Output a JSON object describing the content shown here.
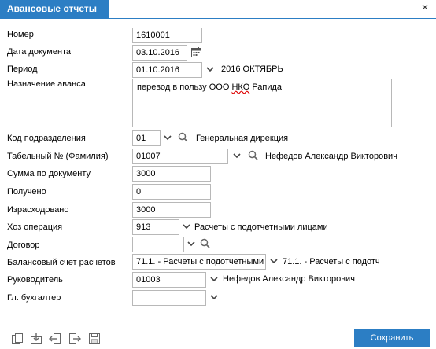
{
  "window": {
    "title": "Авансовые отчеты",
    "close_glyph": "×"
  },
  "fields": {
    "nomer": {
      "label": "Номер",
      "value": "1610001"
    },
    "data_doc": {
      "label": "Дата документа",
      "value": "03.10.2016"
    },
    "period": {
      "label": "Период",
      "value": "01.10.2016",
      "caption": "2016 ОКТЯБРЬ"
    },
    "naznachenie": {
      "label": "Назначение аванса",
      "value_prefix": "перевод в пользу ООО ",
      "value_marked": "НКО",
      "value_suffix": " Рапида"
    },
    "kod_podr": {
      "label": "Код подразделения",
      "value": "01",
      "caption": "Генеральная дирекция"
    },
    "tabel": {
      "label": "Табельный № (Фамилия)",
      "value": "01007",
      "caption": "Нефедов Александр Викторович"
    },
    "summa": {
      "label": "Сумма по документу",
      "value": "3000"
    },
    "polucheno": {
      "label": "Получено",
      "value": "0"
    },
    "izrashodovano": {
      "label": "Израсходовано",
      "value": "3000"
    },
    "hoz_oper": {
      "label": "Хоз операция",
      "value": "913",
      "caption": "Расчеты с подотчетными лицами"
    },
    "dogovor": {
      "label": "Договор",
      "value": ""
    },
    "balans": {
      "label": "Балансовый счет расчетов",
      "value": "71.1. - Расчеты с подотчетными",
      "caption": "71.1. - Расчеты с подотч"
    },
    "rukovoditel": {
      "label": "Руководитель",
      "value": "01003",
      "caption": "Нефедов Александр Викторович"
    },
    "buhgalter": {
      "label": "Гл. бухгалтер",
      "value": ""
    }
  },
  "toolbar": {
    "icons": [
      "copy-icon",
      "import-icon",
      "export-left-icon",
      "export-right-icon",
      "save-disk-icon"
    ]
  },
  "save_button": {
    "label": "Сохранить"
  },
  "colors": {
    "accent": "#2c7ec4",
    "border": "#b8b8b8",
    "icon": "#555555"
  }
}
